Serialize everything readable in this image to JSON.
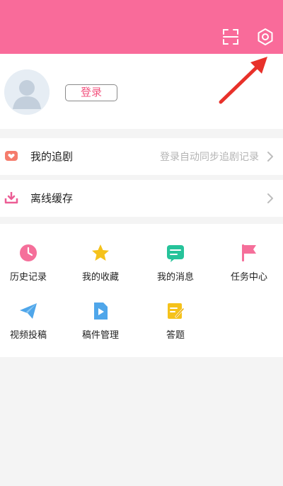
{
  "profile": {
    "login_label": "登录"
  },
  "rows": [
    {
      "label": "我的追剧",
      "hint": "登录自动同步追剧记录",
      "icon": "heart-tv-icon"
    },
    {
      "label": "离线缓存",
      "hint": "",
      "icon": "download-icon"
    }
  ],
  "grid": [
    {
      "label": "历史记录",
      "icon": "clock-icon",
      "color": "#f56f9a"
    },
    {
      "label": "我的收藏",
      "icon": "star-icon",
      "color": "#f5c21b"
    },
    {
      "label": "我的消息",
      "icon": "message-icon",
      "color": "#26c39a"
    },
    {
      "label": "任务中心",
      "icon": "flag-icon",
      "color": "#f56f9a"
    },
    {
      "label": "视频投稿",
      "icon": "paper-plane-icon",
      "color": "#4fa6ea"
    },
    {
      "label": "稿件管理",
      "icon": "video-file-icon",
      "color": "#4fa6ea"
    },
    {
      "label": "答题",
      "icon": "edit-note-icon",
      "color": "#f5c21b"
    }
  ],
  "colors": {
    "header": "#f96b9a",
    "accent": "#f2547f",
    "arrow": "#e8312a"
  }
}
